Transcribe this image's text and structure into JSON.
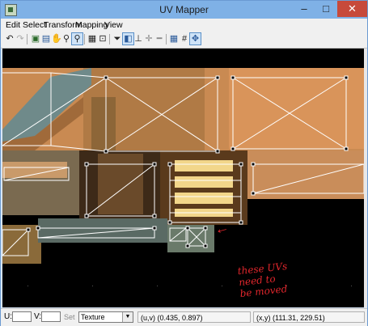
{
  "window": {
    "title": "UV Mapper",
    "controls": {
      "minimize": "–",
      "maximize": "□",
      "close": "✕"
    }
  },
  "menu": [
    "Edit",
    "Select",
    "Transform",
    "Mapping",
    "View"
  ],
  "toolbar": {
    "icons": [
      "undo-icon",
      "redo-icon",
      "select-icon",
      "move-icon",
      "hand-icon",
      "zoom-icon",
      "zoom-fit-icon",
      "box-icon",
      "fit-icon",
      "filter-icon",
      "split-icon",
      "align-icon",
      "plus-icon",
      "minus-icon",
      "grid-icon",
      "snap-grid-icon",
      "center-icon"
    ]
  },
  "annotation": {
    "lines": [
      "these UVs",
      "need to",
      "be moved"
    ],
    "arrow": "←",
    "color": "#e0262c"
  },
  "status": {
    "u_label": "U:",
    "u_value": "",
    "v_label": "V:",
    "v_value": "",
    "set_label": "Set",
    "mode": "Texture",
    "uv_readout": "(u,v) (0.435, 0.897)",
    "xy_readout": "(x,y) (111.31, 229.51)"
  },
  "colors": {
    "title_bar": "#7fb1e6",
    "close": "#c74a3b",
    "wireframe": "#ffffff",
    "canvas": "#000000"
  }
}
